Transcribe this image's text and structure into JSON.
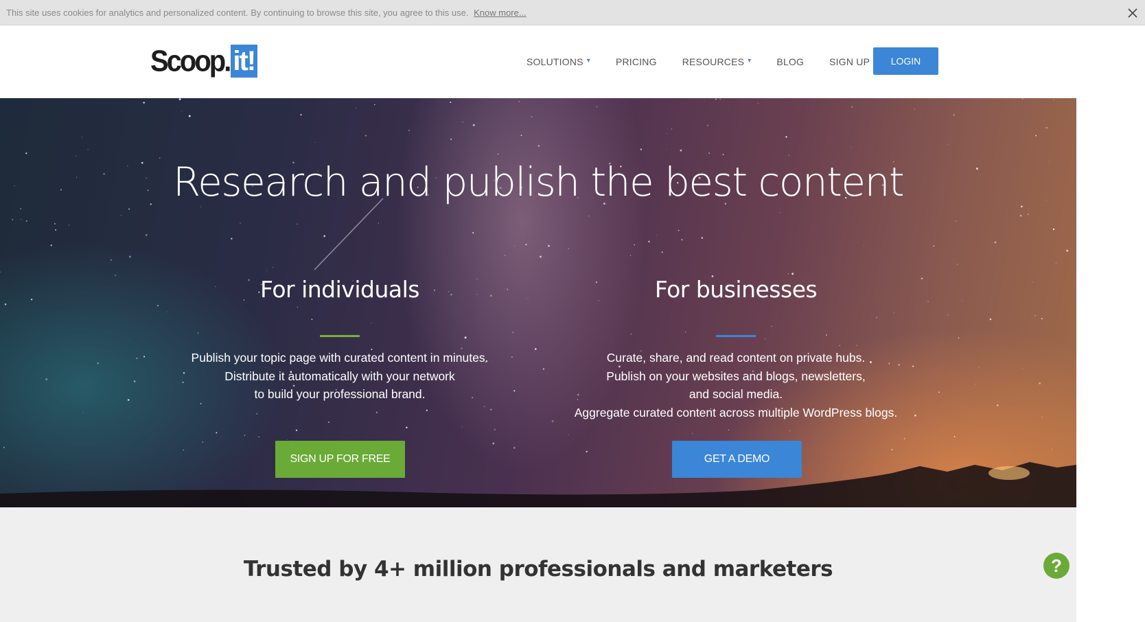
{
  "cookie_bar": {
    "text": "This site uses cookies for analytics and personalized content. By continuing to browse this site, you agree to this use.",
    "link": "Know more...",
    "close_icon": "close-icon"
  },
  "header": {
    "logo": {
      "part1": "Scoop.",
      "part2": "it!"
    },
    "nav": [
      {
        "label": "SOLUTIONS",
        "caret": "▾"
      },
      {
        "label": "PRICING"
      },
      {
        "label": "RESOURCES",
        "caret": "▾"
      },
      {
        "label": "BLOG"
      },
      {
        "label": "SIGN UP"
      }
    ],
    "login": "LOGIN"
  },
  "hero": {
    "title": "Research and publish the best content",
    "individuals": {
      "heading": "For individuals",
      "lines": [
        "Publish your topic page with curated content in minutes.",
        "Distribute it automatically with your network",
        "to build your professional brand."
      ],
      "cta": "SIGN UP FOR FREE"
    },
    "businesses": {
      "heading": "For businesses",
      "lines": [
        "Curate, share, and read content on private hubs.",
        "Publish on your websites and blogs, newsletters,",
        "and social media.",
        "Aggregate curated content across multiple WordPress blogs."
      ],
      "cta": "GET A DEMO"
    }
  },
  "lower": {
    "trusted": "Trusted by 4+ million professionals and marketers"
  },
  "help": {
    "label": "?",
    "icon": "help-icon"
  },
  "colors": {
    "primary_blue": "#3b86d6",
    "green": "#6aaa36",
    "cookie_bg": "#e3e3e3",
    "lower_bg": "#efefef"
  }
}
